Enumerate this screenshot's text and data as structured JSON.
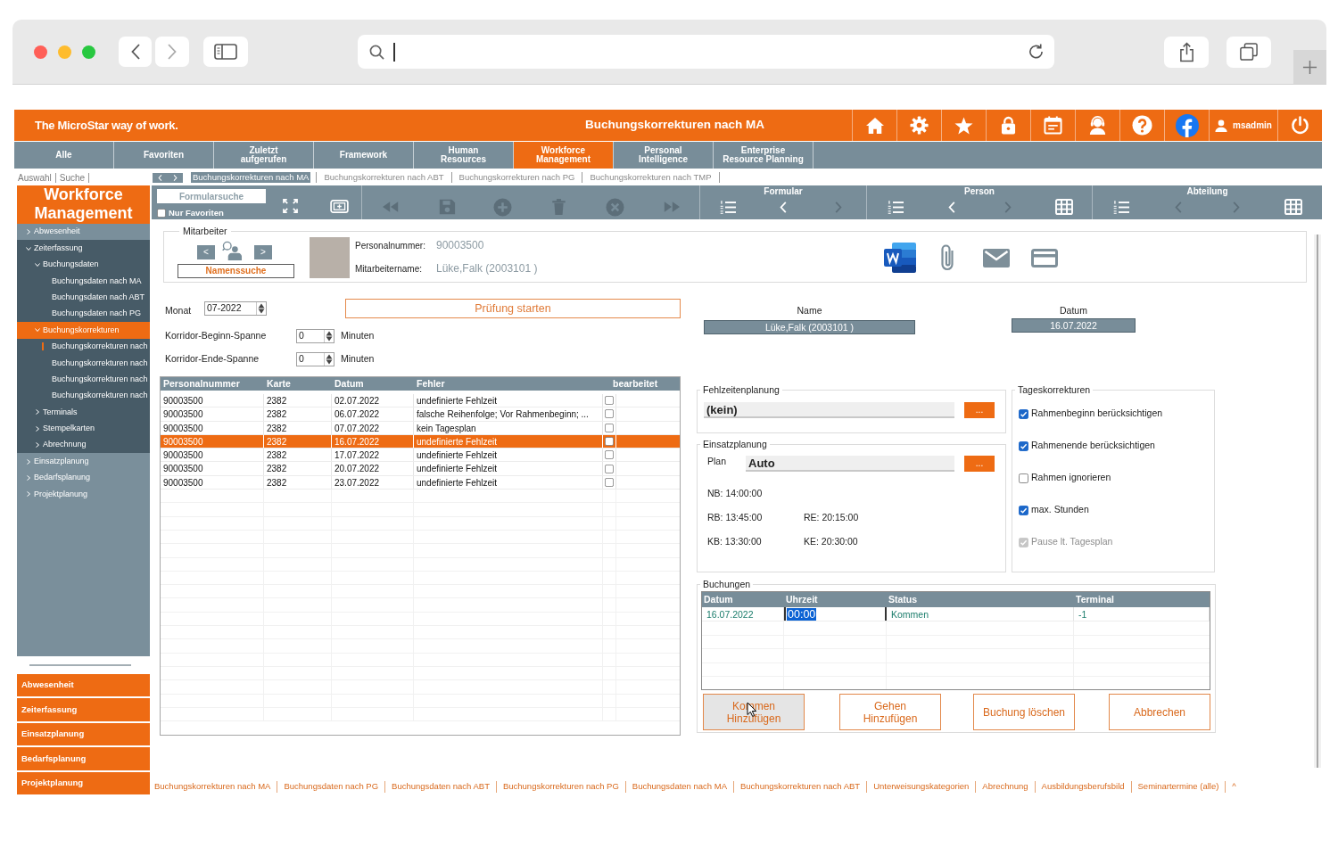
{
  "app_header": {
    "tagline": "The MicroStar way of work.",
    "title": "Buchungskorrekturen nach MA",
    "user": "msadmin"
  },
  "nav_tabs": [
    {
      "label": "Alle",
      "selected": false
    },
    {
      "label": "Favoriten",
      "selected": false
    },
    {
      "label": "Zuletzt\naufgerufen",
      "selected": false
    },
    {
      "label": "Framework",
      "selected": false
    },
    {
      "label": "Human\nResources",
      "selected": false
    },
    {
      "label": "Workforce\nManagement",
      "selected": true
    },
    {
      "label": "Personal\nIntelligence",
      "selected": false
    },
    {
      "label": "Enterprise\nResource Planning",
      "selected": false
    }
  ],
  "subnav": [
    "Auswahl",
    "Suche"
  ],
  "open_forms": [
    {
      "label": "Buchungskorrekturen nach MA",
      "selected": true
    },
    {
      "label": "Buchungskorrekturen nach ABT",
      "selected": false
    },
    {
      "label": "Buchungskorrekturen nach PG",
      "selected": false
    },
    {
      "label": "Buchungskorrekturen nach TMP",
      "selected": false
    }
  ],
  "sidebar": {
    "title": "Workforce\nManagement",
    "tree": [
      {
        "label": "Abwesenheit",
        "expanded": false,
        "selected": false
      },
      {
        "label": "Zeiterfassung",
        "expanded": true,
        "selected": false,
        "children": [
          {
            "label": "Buchungsdaten",
            "expanded": true,
            "selected": false,
            "children": [
              {
                "label": "Buchungsdaten nach MA",
                "selected": false,
                "marked": false
              },
              {
                "label": "Buchungsdaten nach ABT",
                "selected": false,
                "marked": false
              },
              {
                "label": "Buchungsdaten nach PG",
                "selected": false,
                "marked": false
              }
            ]
          },
          {
            "label": "Buchungskorrekturen",
            "expanded": true,
            "selected": true,
            "children": [
              {
                "label": "Buchungskorrekturen nach",
                "selected": false,
                "marked": true
              },
              {
                "label": "Buchungskorrekturen nach",
                "selected": false,
                "marked": false
              },
              {
                "label": "Buchungskorrekturen nach",
                "selected": false,
                "marked": false
              },
              {
                "label": "Buchungskorrekturen nach",
                "selected": false,
                "marked": false
              }
            ]
          },
          {
            "label": "Terminals",
            "expanded": false,
            "selected": false
          },
          {
            "label": "Stempelkarten",
            "expanded": false,
            "selected": false
          },
          {
            "label": "Abrechnung",
            "expanded": false,
            "selected": false
          }
        ]
      },
      {
        "label": "Einsatzplanung",
        "expanded": false,
        "selected": false
      },
      {
        "label": "Bedarfsplanung",
        "expanded": false,
        "selected": false
      },
      {
        "label": "Projektplanung",
        "expanded": false,
        "selected": false
      }
    ],
    "quick_links": [
      "Abwesenheit",
      "Zeiterfassung",
      "Einsatzplanung",
      "Bedarfsplanung",
      "Projektplanung"
    ]
  },
  "toolbar": {
    "search": {
      "placeholder": "Formularsuche"
    },
    "favorites_only": {
      "label": "Nur Favoriten",
      "checked": false
    },
    "record_buttons": [
      {
        "kind": "first",
        "disabled": true
      },
      {
        "kind": "save",
        "disabled": true
      },
      {
        "kind": "add",
        "disabled": true
      },
      {
        "kind": "delete",
        "disabled": true
      },
      {
        "kind": "cancel",
        "disabled": true
      },
      {
        "kind": "last",
        "disabled": true
      }
    ],
    "groups": [
      {
        "title": "Formular",
        "buttons": [
          {
            "kind": "list",
            "disabled": false
          },
          {
            "kind": "previous",
            "disabled": false
          },
          {
            "kind": "next",
            "disabled": true
          }
        ]
      },
      {
        "title": "Person",
        "buttons": [
          {
            "kind": "list",
            "disabled": false
          },
          {
            "kind": "previous",
            "disabled": false
          },
          {
            "kind": "next",
            "disabled": true
          },
          {
            "kind": "grid",
            "disabled": false
          }
        ]
      },
      {
        "title": "Abteilung",
        "buttons": [
          {
            "kind": "list",
            "disabled": false
          },
          {
            "kind": "previous",
            "disabled": true
          },
          {
            "kind": "next",
            "disabled": true
          },
          {
            "kind": "grid",
            "disabled": false
          }
        ]
      }
    ]
  },
  "employee": {
    "legend": "Mitarbeiter",
    "previous": "<",
    "next": ">",
    "search_button": "Namenssuche",
    "fields": [
      {
        "label": "Personalnummer:",
        "value": "90003500"
      },
      {
        "label": "Mitarbeitername:",
        "value": "Lüke,Falk (2003101 )"
      }
    ]
  },
  "check": {
    "month": {
      "label": "Monat",
      "value": "07-2022"
    },
    "start_button": "Prüfung starten",
    "spans": [
      {
        "label": "Korridor-Beginn-Spanne",
        "value": "0",
        "unit": "Minuten"
      },
      {
        "label": "Korridor-Ende-Spanne",
        "value": "0",
        "unit": "Minuten"
      }
    ]
  },
  "errors_table": {
    "columns": [
      "Personalnummer",
      "Karte",
      "Datum",
      "Fehler",
      "bearbeitet"
    ],
    "rows": [
      {
        "cells": [
          "90003500",
          "2382",
          "02.07.2022",
          "undefinierte Fehlzeit"
        ],
        "edited": false,
        "selected": false
      },
      {
        "cells": [
          "90003500",
          "2382",
          "06.07.2022",
          "falsche Reihenfolge; Vor Rahmenbeginn; ..."
        ],
        "edited": false,
        "selected": false
      },
      {
        "cells": [
          "90003500",
          "2382",
          "07.07.2022",
          "kein Tagesplan"
        ],
        "edited": false,
        "selected": false
      },
      {
        "cells": [
          "90003500",
          "2382",
          "16.07.2022",
          "undefinierte Fehlzeit"
        ],
        "edited": false,
        "selected": true
      },
      {
        "cells": [
          "90003500",
          "2382",
          "17.07.2022",
          "undefinierte Fehlzeit"
        ],
        "edited": false,
        "selected": false
      },
      {
        "cells": [
          "90003500",
          "2382",
          "20.07.2022",
          "undefinierte Fehlzeit"
        ],
        "edited": false,
        "selected": false
      },
      {
        "cells": [
          "90003500",
          "2382",
          "23.07.2022",
          "undefinierte Fehlzeit"
        ],
        "edited": false,
        "selected": false
      }
    ]
  },
  "selection": [
    {
      "label": "Name",
      "value": "Lüke,Falk (2003101 )"
    },
    {
      "label": "Datum",
      "value": "16.07.2022"
    }
  ],
  "absence_planning": {
    "legend": "Fehlzeitenplanung",
    "value": "(kein)",
    "button": "..."
  },
  "shift_planning": {
    "legend": "Einsatzplanung",
    "label": "Plan",
    "value": "Auto",
    "button": "...",
    "times": [
      [
        "NB: 14:00:00"
      ],
      [
        "RB: 13:45:00",
        "RE: 20:15:00"
      ],
      [
        "KB: 13:30:00",
        "KE: 20:30:00"
      ]
    ]
  },
  "day_corrections": {
    "legend": "Tageskorrekturen",
    "options": [
      {
        "label": "Rahmenbeginn berücksichtigen",
        "checked": true,
        "disabled": false
      },
      {
        "label": "Rahmenende berücksichtigen",
        "checked": true,
        "disabled": false
      },
      {
        "label": "Rahmen ignorieren",
        "checked": false,
        "disabled": false
      },
      {
        "label": "max. Stunden",
        "checked": true,
        "disabled": false
      },
      {
        "label": "Pause lt. Tagesplan",
        "checked": true,
        "disabled": true
      }
    ]
  },
  "bookings": {
    "legend": "Buchungen",
    "columns": [
      "Datum",
      "Uhrzeit",
      "Status",
      "Terminal"
    ],
    "rows": [
      {
        "cells": [
          {
            "text": "16.07.2022",
            "editing": false
          },
          {
            "text": "00:00",
            "editing": true
          },
          {
            "text": "Kommen",
            "editing": false
          },
          {
            "text": "-1",
            "editing": false
          }
        ]
      }
    ],
    "buttons": [
      {
        "label": "Kommen\nHinzufügen",
        "hovered": true
      },
      {
        "label": "Gehen\nHinzufügen",
        "hovered": false
      },
      {
        "label": "Buchung löschen",
        "hovered": false
      },
      {
        "label": "Abbrechen",
        "hovered": false
      }
    ]
  },
  "footer_links": [
    "Buchungskorrekturen nach MA",
    "Buchungsdaten nach PG",
    "Buchungsdaten nach ABT",
    "Buchungskorrekturen nach PG",
    "Buchungsdaten nach MA",
    "Buchungskorrekturen nach ABT",
    "Unterweisungskategorien",
    "Abrechnung",
    "Ausbildungsberufsbild",
    "Seminartermine (alle)",
    "^"
  ]
}
